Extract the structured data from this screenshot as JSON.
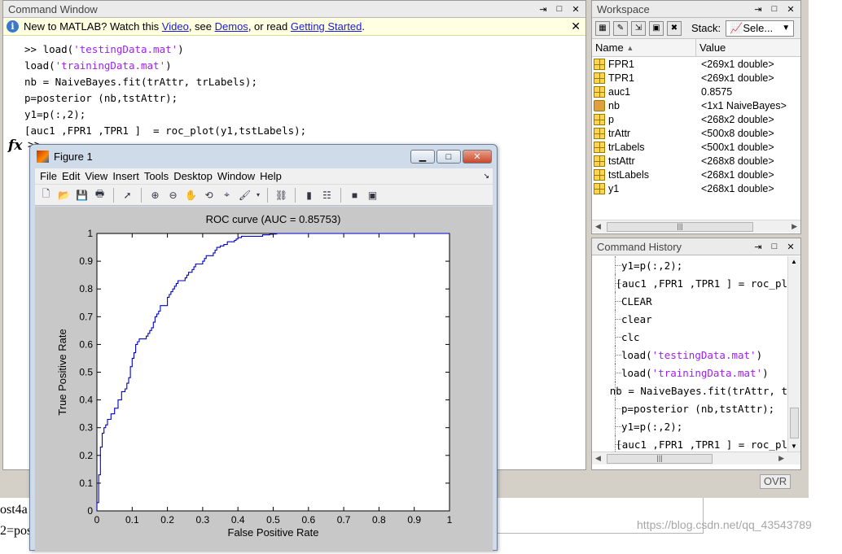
{
  "command_window": {
    "title": "Command Window",
    "news": {
      "prefix": "New to MATLAB? Watch this",
      "link_video": "Video",
      "sep1": ", see",
      "link_demos": "Demos",
      "sep2": ", or read",
      "link_getting_started": "Getting Started",
      "suffix": "."
    },
    "lines": [
      {
        "pre": ">> load(",
        "str": "'testingData.mat'",
        "post": ")"
      },
      {
        "pre": "load(",
        "str": "'trainingData.mat'",
        "post": ")"
      },
      {
        "pre": "nb = NaiveBayes.fit(trAttr, trLabels);",
        "str": "",
        "post": ""
      },
      {
        "pre": "p=posterior (nb,tstAttr);",
        "str": "",
        "post": ""
      },
      {
        "pre": "y1=p(:,2);",
        "str": "",
        "post": ""
      },
      {
        "pre": "[auc1 ,FPR1 ,TPR1 ]  = roc_plot(y1,tstLabels);",
        "str": "",
        "post": ""
      }
    ],
    "fx_symbol": "fx",
    "prompt": ">>"
  },
  "workspace": {
    "title": "Workspace",
    "stack_label": "Stack:",
    "stack_value": "Sele...",
    "col_name": "Name",
    "col_value": "Value",
    "vars": [
      {
        "name": "FPR1",
        "value": "<269x1 double>",
        "icon": "matrix-icon"
      },
      {
        "name": "TPR1",
        "value": "<269x1 double>",
        "icon": "matrix-icon"
      },
      {
        "name": "auc1",
        "value": "0.8575",
        "icon": "matrix-icon"
      },
      {
        "name": "nb",
        "value": "<1x1 NaiveBayes>",
        "icon": "object-icon"
      },
      {
        "name": "p",
        "value": "<268x2 double>",
        "icon": "matrix-icon"
      },
      {
        "name": "trAttr",
        "value": "<500x8 double>",
        "icon": "matrix-icon"
      },
      {
        "name": "trLabels",
        "value": "<500x1 double>",
        "icon": "matrix-icon"
      },
      {
        "name": "tstAttr",
        "value": "<268x8 double>",
        "icon": "matrix-icon"
      },
      {
        "name": "tstLabels",
        "value": "<268x1 double>",
        "icon": "matrix-icon"
      },
      {
        "name": "y1",
        "value": "<268x1 double>",
        "icon": "matrix-icon"
      }
    ]
  },
  "history": {
    "title": "Command History",
    "items": [
      {
        "pre": "y1=p(:,2);",
        "str": "",
        "post": ""
      },
      {
        "pre": "[auc1 ,FPR1 ,TPR1 ]  = roc_pl",
        "str": "",
        "post": ""
      },
      {
        "pre": "CLEAR",
        "str": "",
        "post": ""
      },
      {
        "pre": "clear",
        "str": "",
        "post": ""
      },
      {
        "pre": "clc",
        "str": "",
        "post": ""
      },
      {
        "pre": "load(",
        "str": "'testingData.mat'",
        "post": ")"
      },
      {
        "pre": "load(",
        "str": "'trainingData.mat'",
        "post": ")"
      },
      {
        "pre": "nb = NaiveBayes.fit(trAttr, t",
        "str": "",
        "post": ""
      },
      {
        "pre": "p=posterior (nb,tstAttr);",
        "str": "",
        "post": ""
      },
      {
        "pre": "y1=p(:,2);",
        "str": "",
        "post": ""
      },
      {
        "pre": "[auc1 ,FPR1 ,TPR1 ]  = roc_pl",
        "str": "",
        "post": ""
      }
    ],
    "status": "OVR"
  },
  "figure": {
    "title": "Figure 1",
    "menu": [
      "File",
      "Edit",
      "View",
      "Insert",
      "Tools",
      "Desktop",
      "Window",
      "Help"
    ]
  },
  "background": {
    "line1": "ost4a",
    "line2": "2=pos",
    "watermark": "https://blog.csdn.net/qq_43543789"
  },
  "colors": {
    "roc_line": "#0000cc",
    "string_literal": "#a020f0",
    "link": "#1a1ad9"
  },
  "chart_data": {
    "type": "line",
    "title": "ROC curve (AUC = 0.85753)",
    "xlabel": "False Positive Rate",
    "ylabel": "True Positive Rate",
    "xlim": [
      0,
      1
    ],
    "ylim": [
      0,
      1
    ],
    "xticks": [
      "0",
      "0.1",
      "0.2",
      "0.3",
      "0.4",
      "0.5",
      "0.6",
      "0.7",
      "0.8",
      "0.9",
      "1"
    ],
    "yticks": [
      "0",
      "0.1",
      "0.2",
      "0.3",
      "0.4",
      "0.5",
      "0.6",
      "0.7",
      "0.8",
      "0.9",
      "1"
    ],
    "grid": false,
    "series": [
      {
        "x": [
          0,
          0,
          0.005,
          0.005,
          0.01,
          0.01,
          0.015,
          0.015,
          0.02,
          0.02,
          0.025,
          0.025,
          0.03,
          0.03,
          0.04,
          0.04,
          0.05,
          0.05,
          0.06,
          0.06,
          0.07,
          0.07,
          0.08,
          0.08,
          0.085,
          0.085,
          0.09,
          0.09,
          0.095,
          0.095,
          0.1,
          0.1,
          0.105,
          0.105,
          0.11,
          0.11,
          0.115,
          0.115,
          0.12,
          0.12,
          0.14,
          0.14,
          0.145,
          0.145,
          0.15,
          0.15,
          0.155,
          0.155,
          0.16,
          0.16,
          0.165,
          0.165,
          0.17,
          0.17,
          0.175,
          0.175,
          0.18,
          0.18,
          0.2,
          0.2,
          0.205,
          0.205,
          0.21,
          0.21,
          0.215,
          0.215,
          0.22,
          0.22,
          0.225,
          0.225,
          0.23,
          0.23,
          0.25,
          0.25,
          0.255,
          0.255,
          0.26,
          0.26,
          0.27,
          0.27,
          0.275,
          0.275,
          0.28,
          0.28,
          0.3,
          0.3,
          0.305,
          0.305,
          0.31,
          0.31,
          0.33,
          0.33,
          0.335,
          0.335,
          0.34,
          0.34,
          0.35,
          0.35,
          0.36,
          0.36,
          0.37,
          0.37,
          0.39,
          0.39,
          0.395,
          0.395,
          0.4,
          0.4,
          0.41,
          0.41,
          0.42,
          0.42,
          0.43,
          0.43,
          0.44,
          0.44,
          0.45,
          0.45,
          0.46,
          0.46,
          0.47,
          0.47,
          0.48,
          0.48,
          0.49,
          0.49,
          0.5,
          0.5,
          0.51,
          0.51,
          0.52,
          0.52,
          1
        ],
        "y": [
          0,
          0.03,
          0.03,
          0.13,
          0.13,
          0.23,
          0.23,
          0.28,
          0.28,
          0.3,
          0.3,
          0.31,
          0.31,
          0.33,
          0.33,
          0.35,
          0.35,
          0.37,
          0.37,
          0.4,
          0.4,
          0.43,
          0.43,
          0.44,
          0.44,
          0.46,
          0.46,
          0.48,
          0.48,
          0.52,
          0.52,
          0.55,
          0.55,
          0.57,
          0.57,
          0.6,
          0.6,
          0.61,
          0.61,
          0.62,
          0.62,
          0.63,
          0.63,
          0.64,
          0.64,
          0.65,
          0.65,
          0.66,
          0.66,
          0.68,
          0.68,
          0.7,
          0.7,
          0.71,
          0.71,
          0.72,
          0.72,
          0.74,
          0.74,
          0.77,
          0.77,
          0.78,
          0.78,
          0.79,
          0.79,
          0.8,
          0.8,
          0.81,
          0.81,
          0.82,
          0.82,
          0.83,
          0.83,
          0.84,
          0.84,
          0.85,
          0.85,
          0.86,
          0.86,
          0.87,
          0.87,
          0.88,
          0.88,
          0.89,
          0.89,
          0.9,
          0.9,
          0.91,
          0.91,
          0.92,
          0.92,
          0.93,
          0.93,
          0.94,
          0.94,
          0.95,
          0.95,
          0.955,
          0.955,
          0.96,
          0.96,
          0.97,
          0.97,
          0.975,
          0.975,
          0.98,
          0.98,
          0.985,
          0.985,
          0.99,
          0.99,
          0.99,
          0.99,
          0.99,
          0.99,
          0.99,
          0.99,
          0.99,
          0.99,
          0.99,
          0.99,
          0.995,
          0.995,
          0.995,
          0.995,
          0.997,
          0.997,
          0.998,
          0.998,
          1,
          1,
          1,
          1
        ]
      }
    ]
  }
}
